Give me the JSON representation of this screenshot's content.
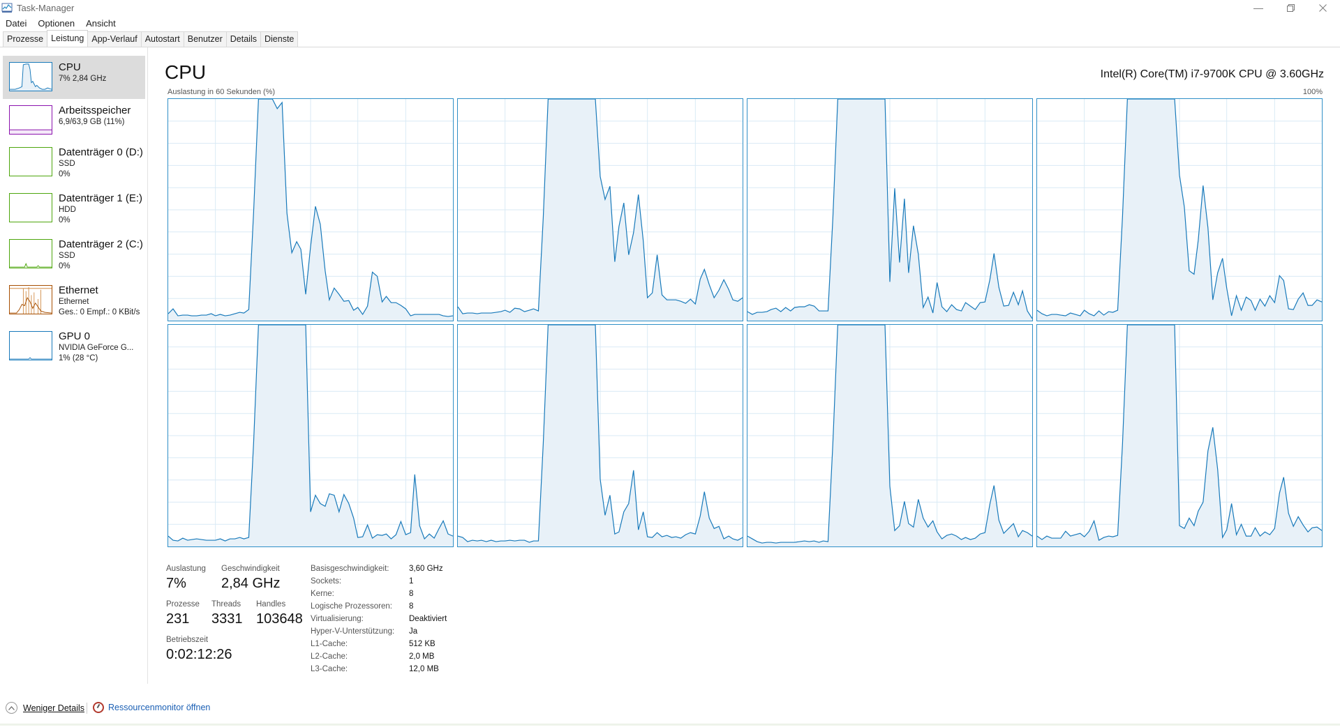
{
  "window": {
    "title": "Task-Manager",
    "controls": [
      "minimize",
      "restore",
      "close"
    ]
  },
  "menu": [
    "Datei",
    "Optionen",
    "Ansicht"
  ],
  "tabs": [
    {
      "label": "Prozesse",
      "active": false
    },
    {
      "label": "Leistung",
      "active": true
    },
    {
      "label": "App-Verlauf",
      "active": false
    },
    {
      "label": "Autostart",
      "active": false
    },
    {
      "label": "Benutzer",
      "active": false
    },
    {
      "label": "Details",
      "active": false
    },
    {
      "label": "Dienste",
      "active": false
    }
  ],
  "sidebar": {
    "items": [
      {
        "title": "CPU",
        "lines": [
          "7% 2,84 GHz"
        ],
        "color": "#1779ba",
        "selected": true
      },
      {
        "title": "Arbeitsspeicher",
        "lines": [
          "6,9/63,9 GB (11%)"
        ],
        "color": "#8b12ae",
        "selected": false
      },
      {
        "title": "Datenträger 0 (D:)",
        "lines": [
          "SSD",
          "0%"
        ],
        "color": "#4da60c",
        "selected": false
      },
      {
        "title": "Datenträger 1 (E:)",
        "lines": [
          "HDD",
          "0%"
        ],
        "color": "#4da60c",
        "selected": false
      },
      {
        "title": "Datenträger 2 (C:)",
        "lines": [
          "SSD",
          "0%"
        ],
        "color": "#4da60c",
        "selected": false
      },
      {
        "title": "Ethernet",
        "lines": [
          "Ethernet",
          "Ges.: 0 Empf.: 0 KBit/s"
        ],
        "color": "#a74f01",
        "selected": false
      },
      {
        "title": "GPU 0",
        "lines": [
          "NVIDIA GeForce G...",
          "1% (28 °C)"
        ],
        "color": "#1779ba",
        "selected": false
      }
    ]
  },
  "main": {
    "title": "CPU",
    "cpu_model": "Intel(R) Core(TM) i7-9700K CPU @ 3.60GHz",
    "graph_label": "Auslastung in 60 Sekunden (%)",
    "graph_max": "100%",
    "core_count": 8,
    "line_color": "#1779ba"
  },
  "stats": {
    "auslastung": {
      "label": "Auslastung",
      "value": "7%"
    },
    "geschwindigkeit": {
      "label": "Geschwindigkeit",
      "value": "2,84 GHz"
    },
    "prozesse": {
      "label": "Prozesse",
      "value": "231"
    },
    "threads": {
      "label": "Threads",
      "value": "3331"
    },
    "handles": {
      "label": "Handles",
      "value": "103648"
    },
    "betriebszeit": {
      "label": "Betriebszeit",
      "value": "0:02:12:26"
    }
  },
  "specs": [
    {
      "key": "Basisgeschwindigkeit:",
      "value": "3,60 GHz"
    },
    {
      "key": "Sockets:",
      "value": "1"
    },
    {
      "key": "Kerne:",
      "value": "8"
    },
    {
      "key": "Logische Prozessoren:",
      "value": "8"
    },
    {
      "key": "Virtualisierung:",
      "value": "Deaktiviert"
    },
    {
      "key": "Hyper-V-Unterstützung:",
      "value": "Ja"
    },
    {
      "key": "L1-Cache:",
      "value": "512 KB"
    },
    {
      "key": "L2-Cache:",
      "value": "2,0 MB"
    },
    {
      "key": "L3-Cache:",
      "value": "12,0 MB"
    }
  ],
  "footer": {
    "fewer_details": "Weniger Details",
    "resource_monitor": "Ressourcenmonitor öffnen"
  }
}
